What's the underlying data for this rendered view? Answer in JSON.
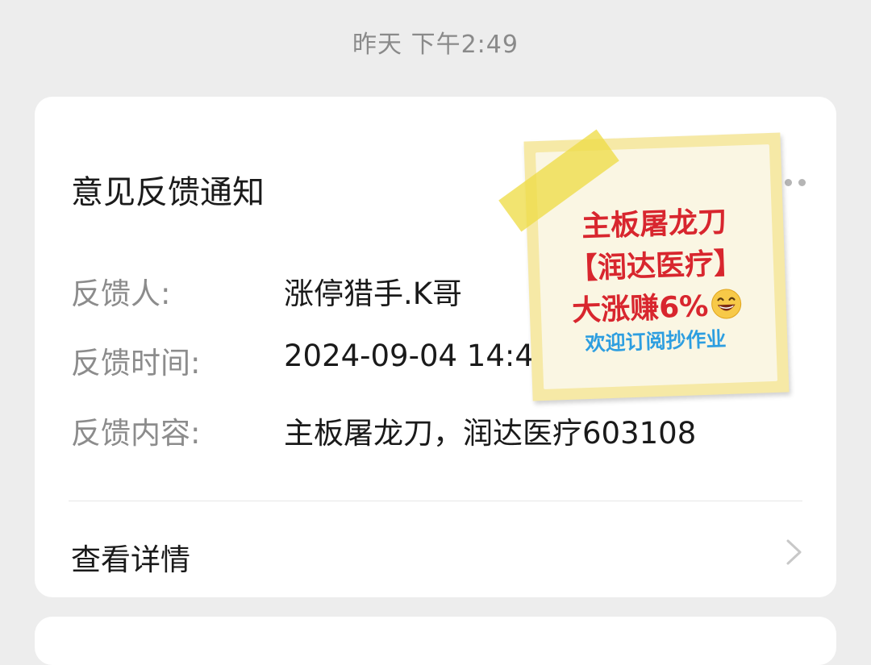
{
  "chat": {
    "timestamp": "昨天 下午2:49"
  },
  "card": {
    "title": "意见反馈通知",
    "rows": [
      {
        "label": "反馈人:",
        "value": "涨停猎手.K哥"
      },
      {
        "label": "反馈时间:",
        "value": "2024-09-04 14:49:"
      },
      {
        "label": "反馈内容:",
        "value": "主板屠龙刀，润达医疗603108"
      }
    ],
    "details_label": "查看详情"
  },
  "sticker": {
    "line1": "主板屠龙刀",
    "line2": "【润达医疗】",
    "line3": "大涨赚6%",
    "subtitle": "欢迎订阅抄作业",
    "emoji_icon": "grinning-face-icon"
  },
  "colors": {
    "background": "#ededed",
    "card": "#ffffff",
    "sticker_red": "#d8262e",
    "sticker_blue": "#2d9ee0",
    "sticker_paper": "#faf6e3",
    "tape": "#eedd48"
  }
}
